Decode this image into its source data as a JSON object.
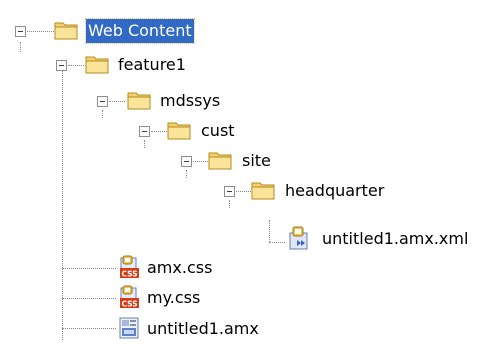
{
  "tree": {
    "items": [
      {
        "label": "Web Content",
        "type": "folder",
        "expanded": true,
        "selected": true
      },
      {
        "label": "feature1",
        "type": "folder",
        "expanded": true
      },
      {
        "label": "mdssys",
        "type": "folder",
        "expanded": true
      },
      {
        "label": "cust",
        "type": "folder",
        "expanded": true
      },
      {
        "label": "site",
        "type": "folder",
        "expanded": true
      },
      {
        "label": "headquarter",
        "type": "folder",
        "expanded": true
      },
      {
        "label": "untitled1.amx.xml",
        "type": "xml-file"
      },
      {
        "label": "amx.css",
        "type": "css-file"
      },
      {
        "label": "my.css",
        "type": "css-file"
      },
      {
        "label": "untitled1.amx",
        "type": "amx-file"
      }
    ]
  },
  "icons": {
    "folder": "folder-icon",
    "css": "css-file-icon",
    "xml": "xml-file-icon",
    "amx": "amx-file-icon"
  },
  "colors": {
    "selection": "#316ac5",
    "folder": "#f3d06b",
    "css_badge": "#d63c17"
  }
}
